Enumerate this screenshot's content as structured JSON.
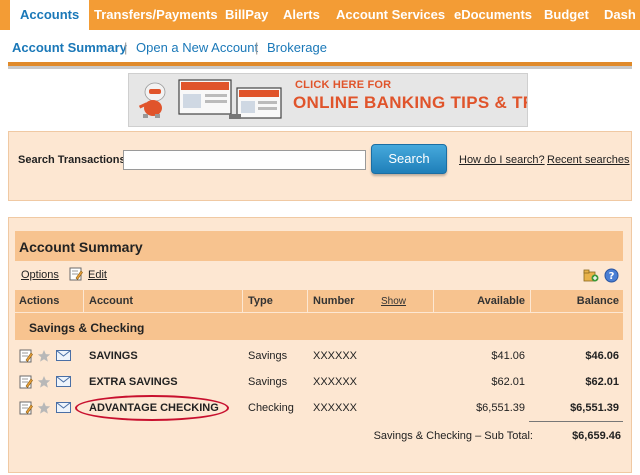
{
  "topnav": {
    "tabs": [
      {
        "label": "Accounts"
      },
      {
        "label": "Transfers/Payments"
      },
      {
        "label": "BillPay"
      },
      {
        "label": "Alerts"
      },
      {
        "label": "Account Services"
      },
      {
        "label": "eDocuments"
      },
      {
        "label": "Budget"
      },
      {
        "label": "Dash"
      }
    ]
  },
  "subnav": {
    "links": [
      {
        "label": "Account Summary"
      },
      {
        "label": "Open a New Account"
      },
      {
        "label": "Brokerage"
      }
    ],
    "separator": "|"
  },
  "banner": {
    "line1": "CLICK HERE FOR",
    "line2": "ONLINE BANKING TIPS & TRICKS",
    "screen_text": "Online Banking Tips and Tricks"
  },
  "search": {
    "label": "Search Transactions:",
    "input_value": "",
    "button_label": "Search",
    "help_link": "How do I search?",
    "recent_link": "Recent searches"
  },
  "summary": {
    "title": "Account Summary",
    "options_link": "Options",
    "edit_link": "Edit",
    "columns": {
      "actions": "Actions",
      "account": "Account",
      "type": "Type",
      "number": "Number",
      "show": "Show",
      "available": "Available",
      "balance": "Balance"
    },
    "group_label": "Savings & Checking",
    "rows": [
      {
        "account": "SAVINGS",
        "type": "Savings",
        "number": "XXXXXX",
        "available": "$41.06",
        "balance": "$46.06"
      },
      {
        "account": "EXTRA SAVINGS",
        "type": "Savings",
        "number": "XXXXXX",
        "available": "$62.01",
        "balance": "$62.01"
      },
      {
        "account": "ADVANTAGE CHECKING",
        "type": "Checking",
        "number": "XXXXXX",
        "available": "$6,551.39",
        "balance": "$6,551.39"
      }
    ],
    "subtotal_label": "Savings & Checking – Sub Total:",
    "subtotal_value": "$6,659.46"
  },
  "colors": {
    "nav_orange": "#f39c35",
    "link_blue": "#1a78b8",
    "panel_bg": "#fde7d2",
    "header_bg": "#f7c38f",
    "highlight_red": "#c8102e"
  }
}
